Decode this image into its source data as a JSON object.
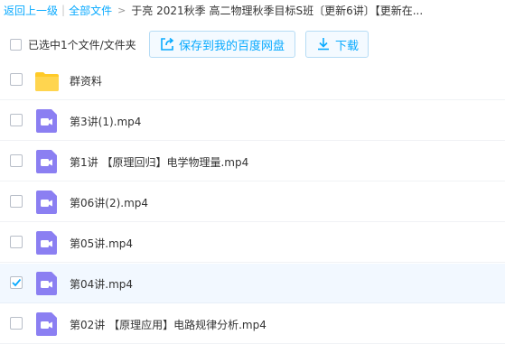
{
  "breadcrumb": {
    "back": "返回上一级",
    "all_files": "全部文件",
    "current": "于亮 2021秋季 高二物理秋季目标S班〔更新6讲〕【更新在..."
  },
  "toolbar": {
    "selection_text": "已选中1个文件/文件夹",
    "save_label": "保存到我的百度网盘",
    "download_label": "下载"
  },
  "colors": {
    "accent": "#09aaff",
    "folder": "#ffca28",
    "video": "#8b7ff2"
  },
  "files": [
    {
      "name": "群资料",
      "type": "folder",
      "checked": false
    },
    {
      "name": "第3讲(1).mp4",
      "type": "video",
      "checked": false
    },
    {
      "name": "第1讲 【原理回归】电学物理量.mp4",
      "type": "video",
      "checked": false
    },
    {
      "name": "第06讲(2).mp4",
      "type": "video",
      "checked": false
    },
    {
      "name": "第05讲.mp4",
      "type": "video",
      "checked": false
    },
    {
      "name": "第04讲.mp4",
      "type": "video",
      "checked": true
    },
    {
      "name": "第02讲 【原理应用】电路规律分析.mp4",
      "type": "video",
      "checked": false
    }
  ]
}
